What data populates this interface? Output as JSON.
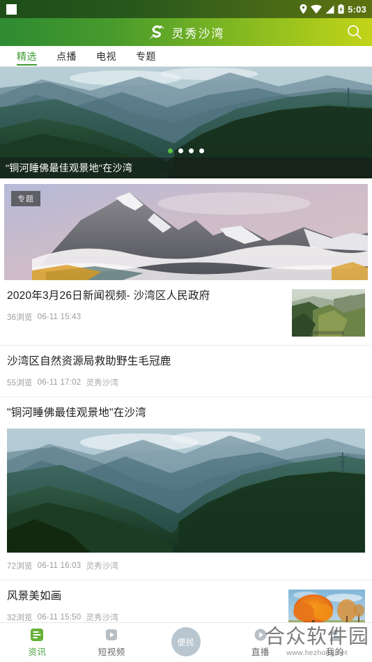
{
  "statusbar": {
    "time": "5:03",
    "icons": [
      "location-pin-icon",
      "wifi-icon",
      "signal-icon",
      "battery-icon"
    ]
  },
  "header": {
    "title": "灵秀沙湾",
    "logo_letter": "S",
    "search_icon": "search-icon"
  },
  "tabs": [
    {
      "label": "精选",
      "active": true
    },
    {
      "label": "点播",
      "active": false
    },
    {
      "label": "电视",
      "active": false
    },
    {
      "label": "专题",
      "active": false
    }
  ],
  "banner": {
    "caption": "\"铜河睡佛最佳观景地\"在沙湾",
    "dot_count": 4,
    "active_dot": 0,
    "active_dot_color": "#5cc13c"
  },
  "feature_card": {
    "badge": "专题"
  },
  "list": [
    {
      "title": "2020年3月26日新闻视频- 沙湾区人民政府",
      "views": "36浏览",
      "date": "06-11 15:43",
      "source": "",
      "thumb": "forest-valley-thumbnail",
      "layout": "thumb-right"
    },
    {
      "title": "沙湾区自然资源局救助野生毛冠鹿",
      "views": "55浏览",
      "date": "06-11 17:02",
      "source": "灵秀沙湾",
      "thumb": "",
      "layout": "text-only"
    },
    {
      "title": "\"铜河睡佛最佳观景地\"在沙湾",
      "views": "72浏览",
      "date": "06-11 16:03",
      "source": "灵秀沙湾",
      "thumb": "mountain-valley-large-image",
      "layout": "big-image"
    },
    {
      "title": "风景美如画",
      "views": "32浏览",
      "date": "06-11 15:50",
      "source": "灵秀沙湾",
      "thumb": "autumn-tree-thumbnail",
      "layout": "thumb-right"
    }
  ],
  "bottomnav": [
    {
      "label": "资讯",
      "icon": "news-icon",
      "active": true
    },
    {
      "label": "短视频",
      "icon": "short-video-icon",
      "active": false
    },
    {
      "label": "便民",
      "icon": "services-circle-icon",
      "active": false,
      "center": true
    },
    {
      "label": "直播",
      "icon": "live-broadcast-icon",
      "active": false
    },
    {
      "label": "我的",
      "icon": "profile-icon",
      "active": false
    }
  ],
  "watermark": {
    "main": "合众软件园",
    "sub": "www.hezhong.net"
  },
  "colors": {
    "brand_green": "#3f9c35",
    "header_gradient_start": "#2e8b32",
    "header_gradient_end": "#c2d418",
    "active_dot": "#5cc13c",
    "nav_active": "#4aa345"
  }
}
